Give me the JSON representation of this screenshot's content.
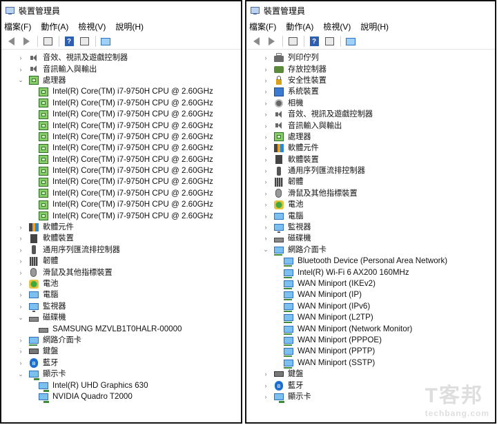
{
  "left_window": {
    "title": "裝置管理員",
    "menu": [
      "檔案(F)",
      "動作(A)",
      "檢視(V)",
      "說明(H)"
    ],
    "tree": [
      {
        "label": "音效、視訊及遊戲控制器",
        "icon": "speaker-icon",
        "exp": "›",
        "child": false
      },
      {
        "label": "音訊輸入與輸出",
        "icon": "speaker-icon",
        "exp": "›",
        "child": false
      },
      {
        "label": "處理器",
        "icon": "cpu-icon",
        "exp": "⌄",
        "child": false
      },
      {
        "label": "Intel(R) Core(TM) i7-9750H CPU @ 2.60GHz",
        "icon": "cpu-icon",
        "exp": "",
        "child": true
      },
      {
        "label": "Intel(R) Core(TM) i7-9750H CPU @ 2.60GHz",
        "icon": "cpu-icon",
        "exp": "",
        "child": true
      },
      {
        "label": "Intel(R) Core(TM) i7-9750H CPU @ 2.60GHz",
        "icon": "cpu-icon",
        "exp": "",
        "child": true
      },
      {
        "label": "Intel(R) Core(TM) i7-9750H CPU @ 2.60GHz",
        "icon": "cpu-icon",
        "exp": "",
        "child": true
      },
      {
        "label": "Intel(R) Core(TM) i7-9750H CPU @ 2.60GHz",
        "icon": "cpu-icon",
        "exp": "",
        "child": true
      },
      {
        "label": "Intel(R) Core(TM) i7-9750H CPU @ 2.60GHz",
        "icon": "cpu-icon",
        "exp": "",
        "child": true
      },
      {
        "label": "Intel(R) Core(TM) i7-9750H CPU @ 2.60GHz",
        "icon": "cpu-icon",
        "exp": "",
        "child": true
      },
      {
        "label": "Intel(R) Core(TM) i7-9750H CPU @ 2.60GHz",
        "icon": "cpu-icon",
        "exp": "",
        "child": true
      },
      {
        "label": "Intel(R) Core(TM) i7-9750H CPU @ 2.60GHz",
        "icon": "cpu-icon",
        "exp": "",
        "child": true
      },
      {
        "label": "Intel(R) Core(TM) i7-9750H CPU @ 2.60GHz",
        "icon": "cpu-icon",
        "exp": "",
        "child": true
      },
      {
        "label": "Intel(R) Core(TM) i7-9750H CPU @ 2.60GHz",
        "icon": "cpu-icon",
        "exp": "",
        "child": true
      },
      {
        "label": "Intel(R) Core(TM) i7-9750H CPU @ 2.60GHz",
        "icon": "cpu-icon",
        "exp": "",
        "child": true
      },
      {
        "label": "軟體元件",
        "icon": "software-icon",
        "exp": "›",
        "child": false
      },
      {
        "label": "軟體裝置",
        "icon": "chip-icon",
        "exp": "›",
        "child": false
      },
      {
        "label": "通用序列匯流排控制器",
        "icon": "usb-icon",
        "exp": "›",
        "child": false
      },
      {
        "label": "韌體",
        "icon": "ram-icon",
        "exp": "›",
        "child": false
      },
      {
        "label": "滑鼠及其他指標裝置",
        "icon": "mouse-icon",
        "exp": "›",
        "child": false
      },
      {
        "label": "電池",
        "icon": "battery-icon",
        "exp": "›",
        "child": false
      },
      {
        "label": "電腦",
        "icon": "pc-icon",
        "exp": "›",
        "child": false
      },
      {
        "label": "監視器",
        "icon": "monitor-icon",
        "exp": "›",
        "child": false
      },
      {
        "label": "磁碟機",
        "icon": "disk-icon",
        "exp": "⌄",
        "child": false
      },
      {
        "label": "SAMSUNG MZVLB1T0HALR-00000",
        "icon": "disk-icon",
        "exp": "",
        "child": true
      },
      {
        "label": "網路介面卡",
        "icon": "network-icon",
        "exp": "›",
        "child": false
      },
      {
        "label": "鍵盤",
        "icon": "keyboard-icon",
        "exp": "›",
        "child": false
      },
      {
        "label": "藍牙",
        "icon": "bluetooth-icon",
        "exp": "›",
        "child": false
      },
      {
        "label": "顯示卡",
        "icon": "display-icon",
        "exp": "⌄",
        "child": false
      },
      {
        "label": "Intel(R) UHD Graphics 630",
        "icon": "display-icon",
        "exp": "",
        "child": true
      },
      {
        "label": "NVIDIA Quadro T2000",
        "icon": "display-icon",
        "exp": "",
        "child": true
      }
    ]
  },
  "right_window": {
    "title": "裝置管理員",
    "menu": [
      "檔案(F)",
      "動作(A)",
      "檢視(V)",
      "說明(H)"
    ],
    "tree": [
      {
        "label": "列印佇列",
        "icon": "printer-icon",
        "exp": "›",
        "child": false
      },
      {
        "label": "存放控制器",
        "icon": "storage-icon",
        "exp": "›",
        "child": false
      },
      {
        "label": "安全性裝置",
        "icon": "lock-icon",
        "exp": "›",
        "child": false
      },
      {
        "label": "系統裝置",
        "icon": "system-icon",
        "exp": "›",
        "child": false
      },
      {
        "label": "相機",
        "icon": "camera-icon",
        "exp": "›",
        "child": false
      },
      {
        "label": "音效、視訊及遊戲控制器",
        "icon": "speaker-icon",
        "exp": "›",
        "child": false
      },
      {
        "label": "音訊輸入與輸出",
        "icon": "speaker-icon",
        "exp": "›",
        "child": false
      },
      {
        "label": "處理器",
        "icon": "cpu-icon",
        "exp": "›",
        "child": false
      },
      {
        "label": "軟體元件",
        "icon": "software-icon",
        "exp": "›",
        "child": false
      },
      {
        "label": "軟體裝置",
        "icon": "chip-icon",
        "exp": "›",
        "child": false
      },
      {
        "label": "通用序列匯流排控制器",
        "icon": "usb-icon",
        "exp": "›",
        "child": false
      },
      {
        "label": "韌體",
        "icon": "ram-icon",
        "exp": "›",
        "child": false
      },
      {
        "label": "滑鼠及其他指標裝置",
        "icon": "mouse-icon",
        "exp": "›",
        "child": false
      },
      {
        "label": "電池",
        "icon": "battery-icon",
        "exp": "›",
        "child": false
      },
      {
        "label": "電腦",
        "icon": "pc-icon",
        "exp": "›",
        "child": false
      },
      {
        "label": "監視器",
        "icon": "monitor-icon",
        "exp": "›",
        "child": false
      },
      {
        "label": "磁碟機",
        "icon": "disk-icon",
        "exp": "›",
        "child": false
      },
      {
        "label": "網路介面卡",
        "icon": "network-icon",
        "exp": "⌄",
        "child": false
      },
      {
        "label": "Bluetooth Device (Personal Area Network)",
        "icon": "network-icon",
        "exp": "",
        "child": true
      },
      {
        "label": "Intel(R) Wi-Fi 6 AX200 160MHz",
        "icon": "network-icon",
        "exp": "",
        "child": true
      },
      {
        "label": "WAN Miniport (IKEv2)",
        "icon": "network-icon",
        "exp": "",
        "child": true
      },
      {
        "label": "WAN Miniport (IP)",
        "icon": "network-icon",
        "exp": "",
        "child": true
      },
      {
        "label": "WAN Miniport (IPv6)",
        "icon": "network-icon",
        "exp": "",
        "child": true
      },
      {
        "label": "WAN Miniport (L2TP)",
        "icon": "network-icon",
        "exp": "",
        "child": true
      },
      {
        "label": "WAN Miniport (Network Monitor)",
        "icon": "network-icon",
        "exp": "",
        "child": true
      },
      {
        "label": "WAN Miniport (PPPOE)",
        "icon": "network-icon",
        "exp": "",
        "child": true
      },
      {
        "label": "WAN Miniport (PPTP)",
        "icon": "network-icon",
        "exp": "",
        "child": true
      },
      {
        "label": "WAN Miniport (SSTP)",
        "icon": "network-icon",
        "exp": "",
        "child": true
      },
      {
        "label": "鍵盤",
        "icon": "keyboard-icon",
        "exp": "›",
        "child": false
      },
      {
        "label": "藍牙",
        "icon": "bluetooth-icon",
        "exp": "›",
        "child": false
      },
      {
        "label": "顯示卡",
        "icon": "display-icon",
        "exp": "›",
        "child": false
      }
    ]
  },
  "watermark": {
    "big": "T客邦",
    "small": "techbang.com"
  }
}
